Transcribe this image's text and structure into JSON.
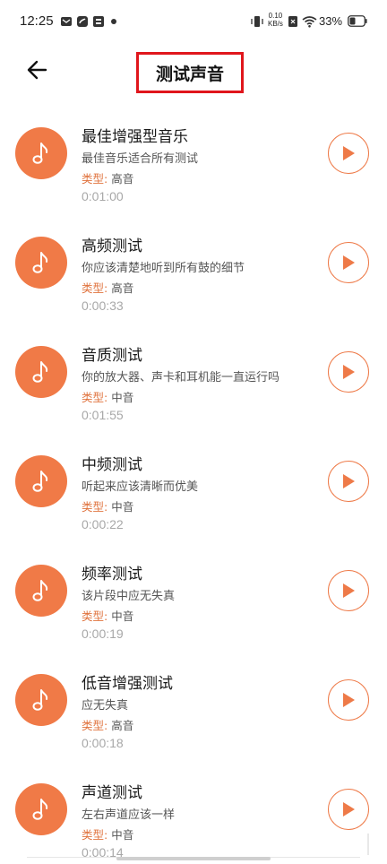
{
  "status_bar": {
    "time": "12:25",
    "net_speed_value": "0.10",
    "net_speed_unit": "KB/s",
    "battery": "33%"
  },
  "header": {
    "title": "测试声音",
    "back_icon": "back-arrow-icon",
    "title_highlight_color": "#e0161c"
  },
  "colors": {
    "accent": "#f07a47",
    "type_label": "#e0743f",
    "duration": "#a8a8a8"
  },
  "type_label": "类型:",
  "tracks": [
    {
      "name": "最佳增强型音乐",
      "description": "最佳音乐适合所有测试",
      "type": "高音",
      "duration": "0:01:00"
    },
    {
      "name": "高频测试",
      "description": "你应该清楚地听到所有鼓的细节",
      "type": "高音",
      "duration": "0:00:33"
    },
    {
      "name": "音质测试",
      "description": "你的放大器、声卡和耳机能一直运行吗",
      "type": "中音",
      "duration": "0:01:55"
    },
    {
      "name": "中频测试",
      "description": "听起来应该清晰而优美",
      "type": "中音",
      "duration": "0:00:22"
    },
    {
      "name": "频率测试",
      "description": "该片段中应无失真",
      "type": "中音",
      "duration": "0:00:19"
    },
    {
      "name": "低音增强测试",
      "description": "应无失真",
      "type": "高音",
      "duration": "0:00:18"
    },
    {
      "name": "声道测试",
      "description": "左右声道应该一样",
      "type": "中音",
      "duration": "0:00:14"
    }
  ]
}
